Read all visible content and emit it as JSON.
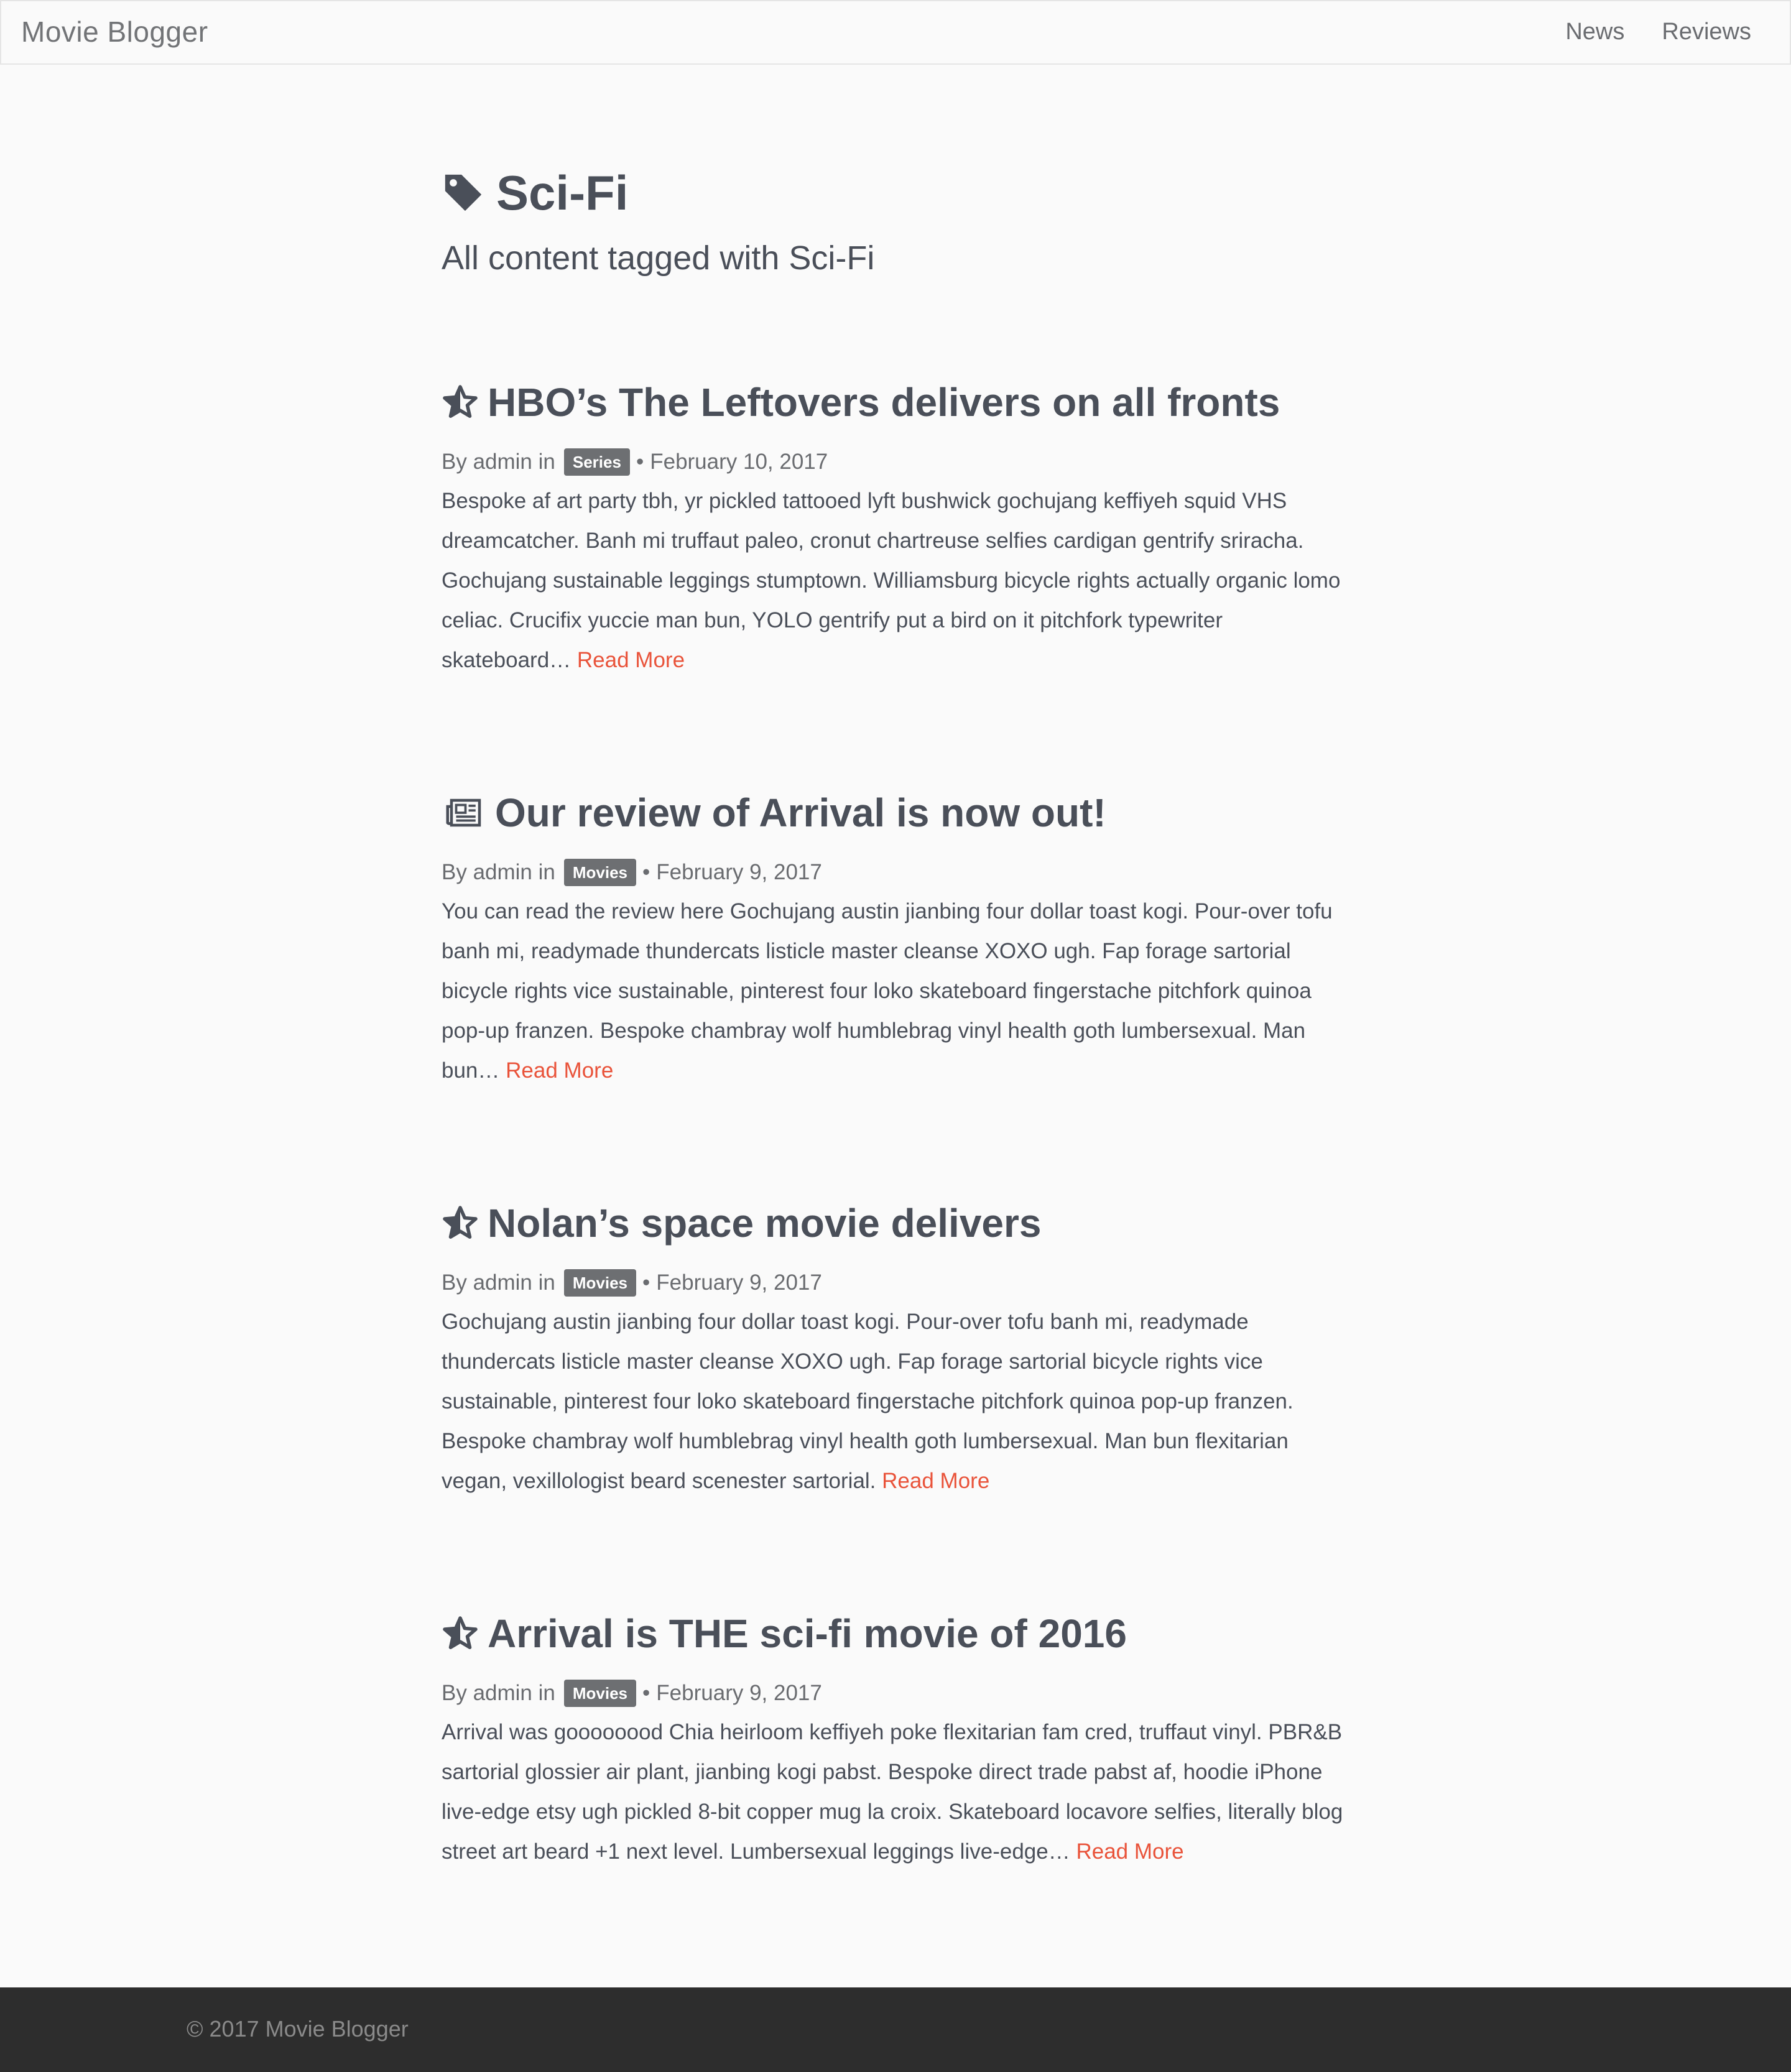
{
  "nav": {
    "brand": "Movie Blogger",
    "links": [
      "News",
      "Reviews"
    ]
  },
  "page": {
    "title": "Sci-Fi",
    "subtitle": "All content tagged with Sci-Fi"
  },
  "posts": [
    {
      "icon": "star-icon",
      "title": "HBO’s The Leftovers delivers on all fronts",
      "by": "By admin in",
      "category": "Series",
      "date": "February 10, 2017",
      "excerpt": "Bespoke af art party tbh, yr pickled tattooed lyft bushwick gochujang keffiyeh squid VHS dreamcatcher. Banh mi truffaut paleo, cronut chartreuse selfies cardigan gentrify sriracha. Gochujang sustainable leggings stumptown. Williamsburg bicycle rights actually organic lomo celiac. Crucifix yuccie man bun, YOLO gentrify put a bird on it pitchfork typewriter skateboard…",
      "read_more": "Read More"
    },
    {
      "icon": "newspaper-icon",
      "title": "Our review of Arrival is now out!",
      "by": "By admin in",
      "category": "Movies",
      "date": "February 9, 2017",
      "excerpt": "You can read the review here Gochujang austin jianbing four dollar toast kogi. Pour-over tofu banh mi, readymade thundercats listicle master cleanse XOXO ugh. Fap forage sartorial bicycle rights vice sustainable, pinterest four loko skateboard fingerstache pitchfork quinoa pop-up franzen. Bespoke chambray wolf humblebrag vinyl health goth lumbersexual. Man bun…",
      "read_more": "Read More"
    },
    {
      "icon": "star-icon",
      "title": "Nolan’s space movie delivers",
      "by": "By admin in",
      "category": "Movies",
      "date": "February 9, 2017",
      "excerpt": "Gochujang austin jianbing four dollar toast kogi. Pour-over tofu banh mi, readymade thundercats listicle master cleanse XOXO ugh. Fap forage sartorial bicycle rights vice sustainable, pinterest four loko skateboard fingerstache pitchfork quinoa pop-up franzen. Bespoke chambray wolf humblebrag vinyl health goth lumbersexual. Man bun flexitarian vegan, vexillologist beard scenester sartorial.",
      "read_more": "Read More"
    },
    {
      "icon": "star-icon",
      "title": "Arrival is THE sci-fi movie of 2016",
      "by": "By admin in",
      "category": "Movies",
      "date": "February 9, 2017",
      "excerpt": "Arrival was goooooood Chia heirloom keffiyeh poke flexitarian fam cred, truffaut vinyl. PBR&B sartorial glossier air plant, jianbing kogi pabst. Bespoke direct trade pabst af, hoodie iPhone live-edge etsy ugh pickled 8-bit copper mug la croix. Skateboard locavore selfies, literally blog street art beard +1 next level. Lumbersexual leggings live-edge…",
      "read_more": "Read More"
    }
  ],
  "footer": {
    "text": "© 2017 Movie Blogger"
  },
  "colors": {
    "accent": "#e9533a",
    "text": "#4a4f59",
    "badge": "#6d6f72",
    "footer_bg": "#2d2d2d"
  }
}
